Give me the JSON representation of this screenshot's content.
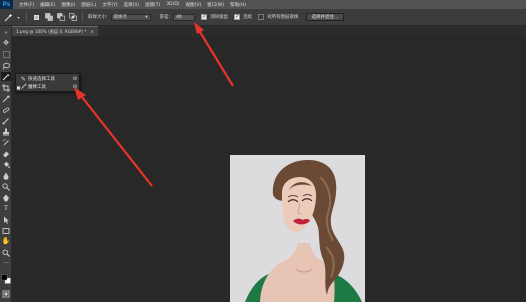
{
  "app": {
    "logo": "Ps"
  },
  "menu": [
    "文件(F)",
    "编辑(E)",
    "图像(I)",
    "图层(L)",
    "文字(Y)",
    "选择(S)",
    "滤镜(T)",
    "3D(D)",
    "视图(V)",
    "窗口(W)",
    "帮助(H)"
  ],
  "options": {
    "sample_size_label": "取样大小:",
    "sample_size_value": "取样点",
    "tolerance_label": "容差:",
    "tolerance_value": "40",
    "antialias_label": "消除锯齿",
    "antialias_checked": true,
    "contiguous_label": "连续",
    "contiguous_checked": true,
    "sample_all_layers_label": "对所有图层取样",
    "sample_all_layers_checked": false,
    "select_subject_label": "选择并遮住..."
  },
  "document_tab": {
    "title": "1.png @ 100% (图层 0, RGB/8#) *",
    "close": "×"
  },
  "flyout": {
    "items": [
      {
        "label": "快速选择工具",
        "shortcut": "W",
        "selected": false
      },
      {
        "label": "魔棒工具",
        "shortcut": "W",
        "selected": true
      }
    ]
  },
  "colors": {
    "menubar": "#535353",
    "optionsbar": "#3c3c3c",
    "workspace": "#282828",
    "annotation_arrow": "#e8332a",
    "ps_blue": "#31a8ff"
  }
}
